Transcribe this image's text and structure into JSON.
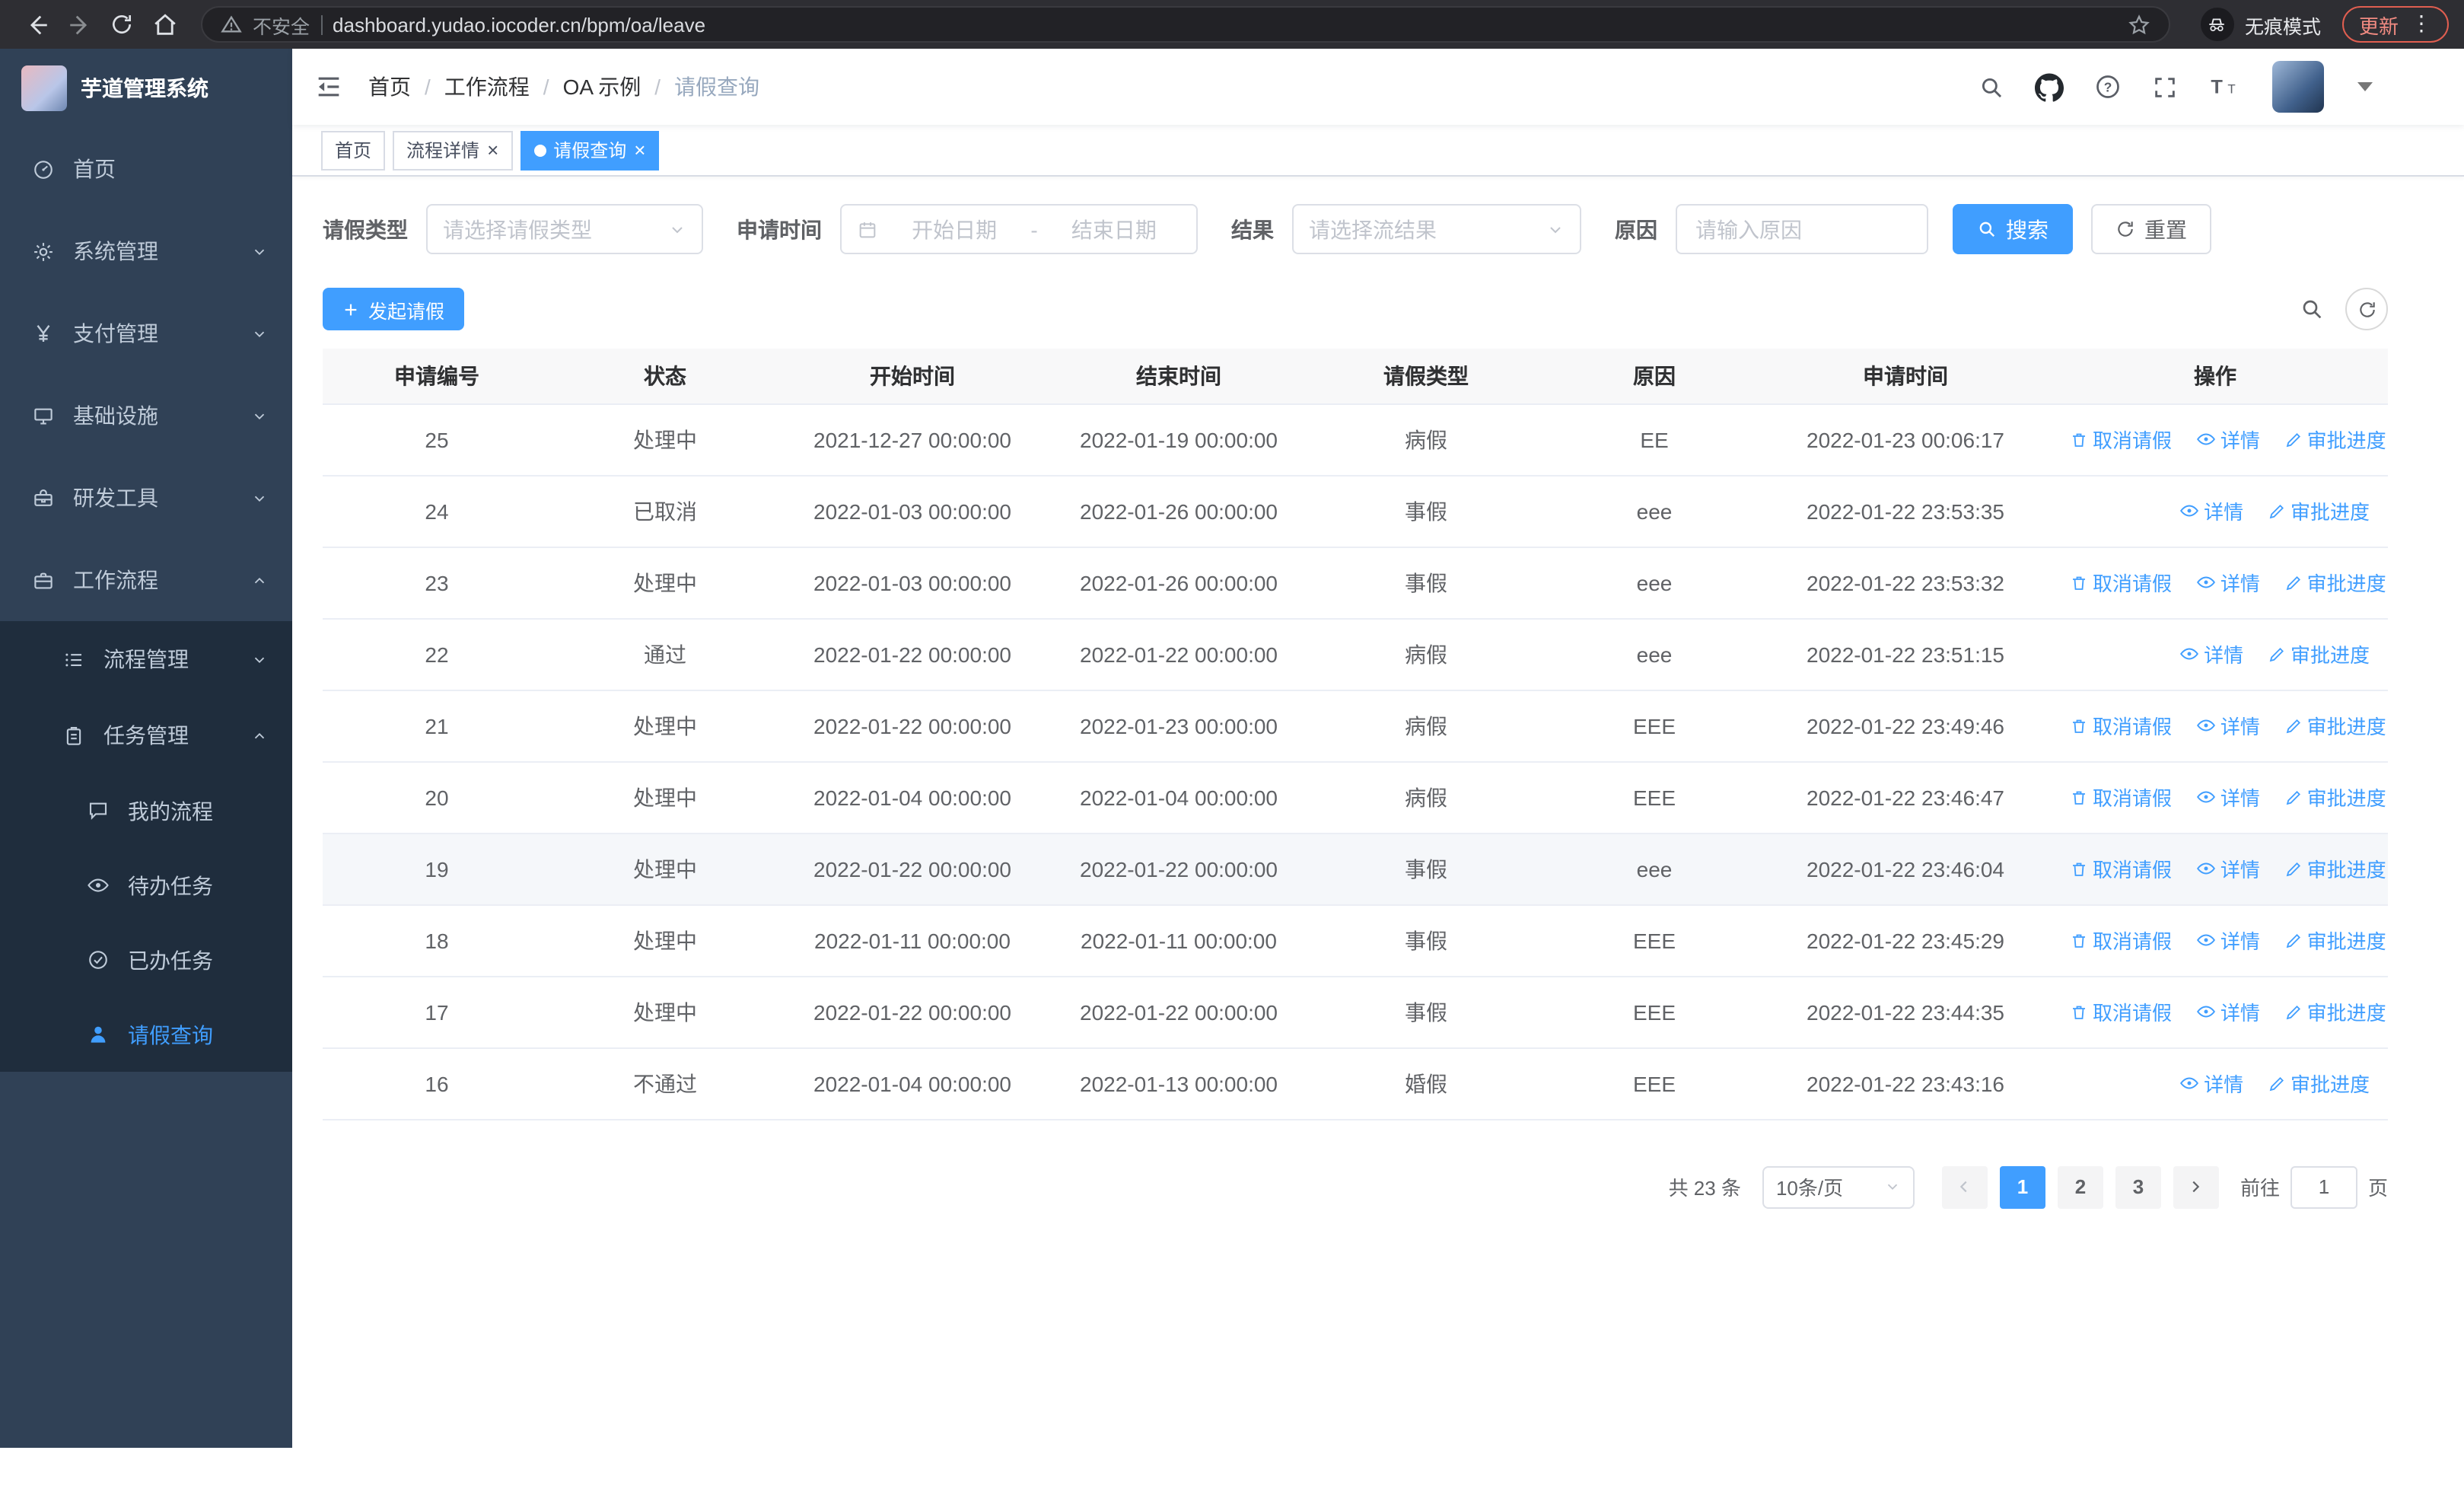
{
  "theme": {
    "primary": "#409eff",
    "sidebar_bg": "#304156",
    "sidebar_sub_bg": "#1f2d3d",
    "sidebar_text": "#bfcbd9",
    "danger": "#f28b82"
  },
  "icons": {
    "security": "warning-triangle",
    "bookmark": "star",
    "incognito": "spy-hat-glasses",
    "menu": "kebab-dots",
    "search": "magnifier",
    "refresh": "circular-arrow",
    "calendar": "calendar-grid",
    "cancel": "trash",
    "detail": "eye",
    "progress": "pen",
    "github": "octocat",
    "help": "question-circle",
    "fullscreen": "corner-arrows",
    "fontsize": "double-T"
  },
  "browser": {
    "security_warning": "不安全",
    "url": "dashboard.yudao.iocoder.cn/bpm/oa/leave",
    "incognito_label": "无痕模式",
    "update_label": "更新"
  },
  "sidebar": {
    "logo_title": "芋道管理系统",
    "items": [
      "首页",
      "系统管理",
      "支付管理",
      "基础设施",
      "研发工具",
      "工作流程"
    ],
    "workflow_children": [
      "流程管理",
      "任务管理"
    ],
    "task_children": [
      "我的流程",
      "待办任务",
      "已办任务",
      "请假查询"
    ],
    "active_item": "请假查询"
  },
  "header": {
    "breadcrumb": [
      "首页",
      "工作流程",
      "OA 示例",
      "请假查询"
    ]
  },
  "tabs": [
    {
      "label": "首页",
      "closable": false,
      "active": false
    },
    {
      "label": "流程详情",
      "closable": true,
      "active": false
    },
    {
      "label": "请假查询",
      "closable": true,
      "active": true
    }
  ],
  "filters": {
    "type_label": "请假类型",
    "type_placeholder": "请选择请假类型",
    "time_label": "申请时间",
    "date_start_placeholder": "开始日期",
    "date_separator": "-",
    "date_end_placeholder": "结束日期",
    "result_label": "结果",
    "result_placeholder": "请选择流结果",
    "reason_label": "原因",
    "reason_placeholder": "请输入原因",
    "search_label": "搜索",
    "reset_label": "重置"
  },
  "toolbar": {
    "create_label": "发起请假"
  },
  "table": {
    "columns": [
      "申请编号",
      "状态",
      "开始时间",
      "结束时间",
      "请假类型",
      "原因",
      "申请时间",
      "操作"
    ],
    "actions": {
      "cancel": "取消请假",
      "detail": "详情",
      "progress": "审批进度"
    },
    "rows": [
      {
        "id": "25",
        "status": "处理中",
        "start": "2021-12-27 00:00:00",
        "end": "2022-01-19 00:00:00",
        "type": "病假",
        "reason": "EE",
        "applied": "2022-01-23 00:06:17",
        "cancelable": true,
        "highlight": false
      },
      {
        "id": "24",
        "status": "已取消",
        "start": "2022-01-03 00:00:00",
        "end": "2022-01-26 00:00:00",
        "type": "事假",
        "reason": "eee",
        "applied": "2022-01-22 23:53:35",
        "cancelable": false,
        "highlight": false
      },
      {
        "id": "23",
        "status": "处理中",
        "start": "2022-01-03 00:00:00",
        "end": "2022-01-26 00:00:00",
        "type": "事假",
        "reason": "eee",
        "applied": "2022-01-22 23:53:32",
        "cancelable": true,
        "highlight": false
      },
      {
        "id": "22",
        "status": "通过",
        "start": "2022-01-22 00:00:00",
        "end": "2022-01-22 00:00:00",
        "type": "病假",
        "reason": "eee",
        "applied": "2022-01-22 23:51:15",
        "cancelable": false,
        "highlight": false
      },
      {
        "id": "21",
        "status": "处理中",
        "start": "2022-01-22 00:00:00",
        "end": "2022-01-23 00:00:00",
        "type": "病假",
        "reason": "EEE",
        "applied": "2022-01-22 23:49:46",
        "cancelable": true,
        "highlight": false
      },
      {
        "id": "20",
        "status": "处理中",
        "start": "2022-01-04 00:00:00",
        "end": "2022-01-04 00:00:00",
        "type": "病假",
        "reason": "EEE",
        "applied": "2022-01-22 23:46:47",
        "cancelable": true,
        "highlight": false
      },
      {
        "id": "19",
        "status": "处理中",
        "start": "2022-01-22 00:00:00",
        "end": "2022-01-22 00:00:00",
        "type": "事假",
        "reason": "eee",
        "applied": "2022-01-22 23:46:04",
        "cancelable": true,
        "highlight": true
      },
      {
        "id": "18",
        "status": "处理中",
        "start": "2022-01-11 00:00:00",
        "end": "2022-01-11 00:00:00",
        "type": "事假",
        "reason": "EEE",
        "applied": "2022-01-22 23:45:29",
        "cancelable": true,
        "highlight": false
      },
      {
        "id": "17",
        "status": "处理中",
        "start": "2022-01-22 00:00:00",
        "end": "2022-01-22 00:00:00",
        "type": "事假",
        "reason": "EEE",
        "applied": "2022-01-22 23:44:35",
        "cancelable": true,
        "highlight": false
      },
      {
        "id": "16",
        "status": "不通过",
        "start": "2022-01-04 00:00:00",
        "end": "2022-01-13 00:00:00",
        "type": "婚假",
        "reason": "EEE",
        "applied": "2022-01-22 23:43:16",
        "cancelable": false,
        "highlight": false
      }
    ]
  },
  "pagination": {
    "total": "共 23 条",
    "page_size": "10条/页",
    "pages": [
      "1",
      "2",
      "3"
    ],
    "active_page": "1",
    "goto": "前往",
    "goto_value": "1",
    "unit": "页"
  }
}
